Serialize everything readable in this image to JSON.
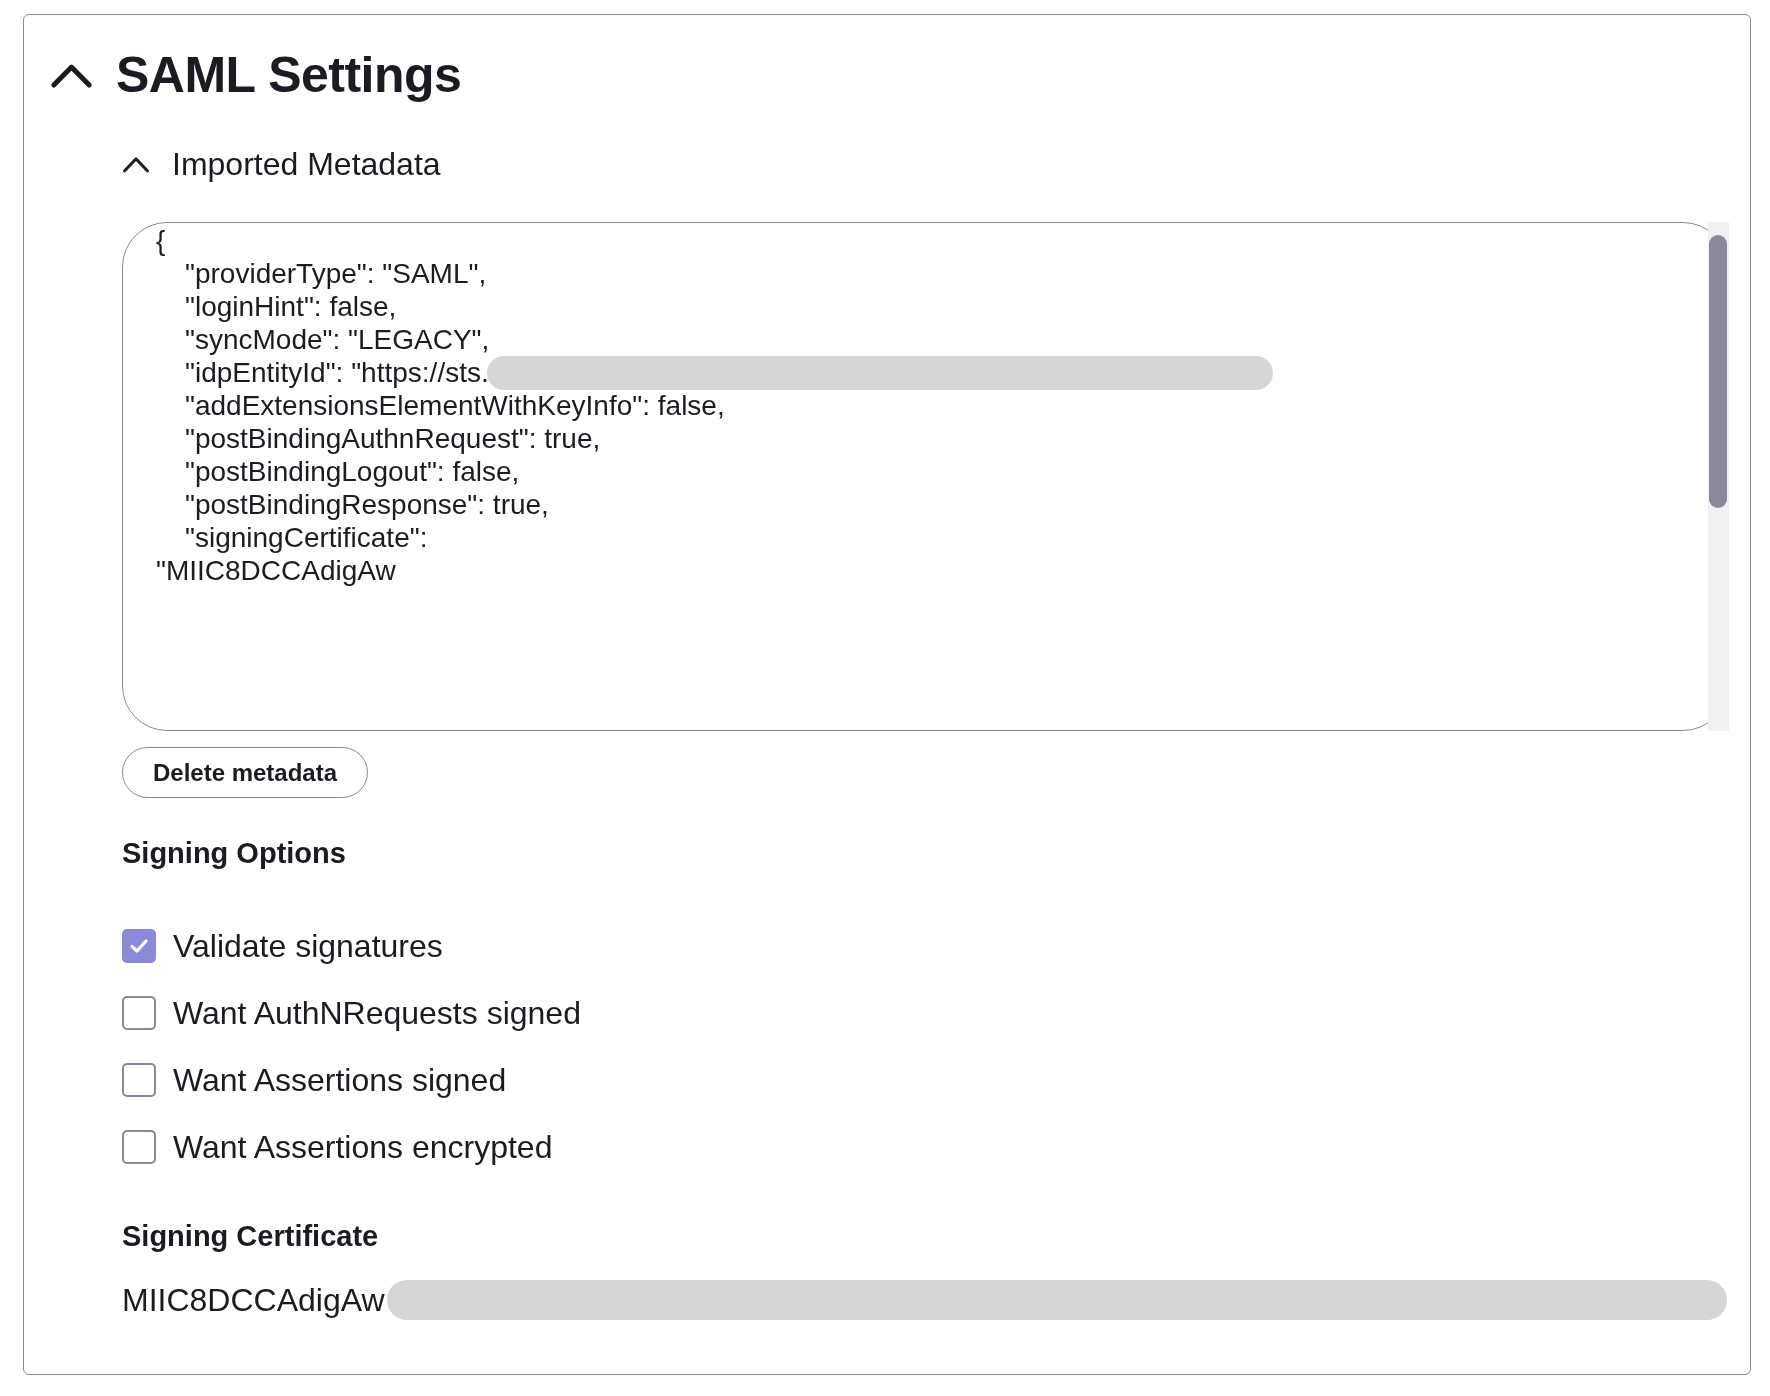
{
  "section": {
    "title": "SAML Settings",
    "expanded": true
  },
  "imported_metadata": {
    "title": "Imported Metadata",
    "expanded": true,
    "lines": [
      {
        "kind": "brace",
        "text": "{",
        "redacted": false
      },
      {
        "kind": "entry",
        "text": "\"providerType\": \"SAML\",",
        "redacted": false
      },
      {
        "kind": "entry",
        "text": "\"loginHint\": false,",
        "redacted": false
      },
      {
        "kind": "entry",
        "text": "\"syncMode\": \"LEGACY\",",
        "redacted": false
      },
      {
        "kind": "entry",
        "text": "\"idpEntityId\": \"https://sts.",
        "redacted": true
      },
      {
        "kind": "entry",
        "text": "\"addExtensionsElementWithKeyInfo\": false,",
        "redacted": false
      },
      {
        "kind": "entry",
        "text": "\"postBindingAuthnRequest\": true,",
        "redacted": false
      },
      {
        "kind": "entry",
        "text": "\"postBindingLogout\": false,",
        "redacted": false
      },
      {
        "kind": "entry",
        "text": "\"postBindingResponse\": true,",
        "redacted": false
      },
      {
        "kind": "entry",
        "text": "\"signingCertificate\":",
        "redacted": false
      },
      {
        "kind": "wrap",
        "text": "\"MIIC8DCCAdigAw",
        "redacted": false
      }
    ],
    "delete_button": "Delete metadata"
  },
  "signing_options": {
    "title": "Signing Options",
    "items": [
      {
        "label": "Validate signatures",
        "checked": true
      },
      {
        "label": "Want AuthNRequests signed",
        "checked": false
      },
      {
        "label": "Want Assertions signed",
        "checked": false
      },
      {
        "label": "Want Assertions encrypted",
        "checked": false
      }
    ]
  },
  "signing_certificate": {
    "title": "Signing Certificate",
    "value": "MIIC8DCCAdigAw",
    "redacted": true
  }
}
